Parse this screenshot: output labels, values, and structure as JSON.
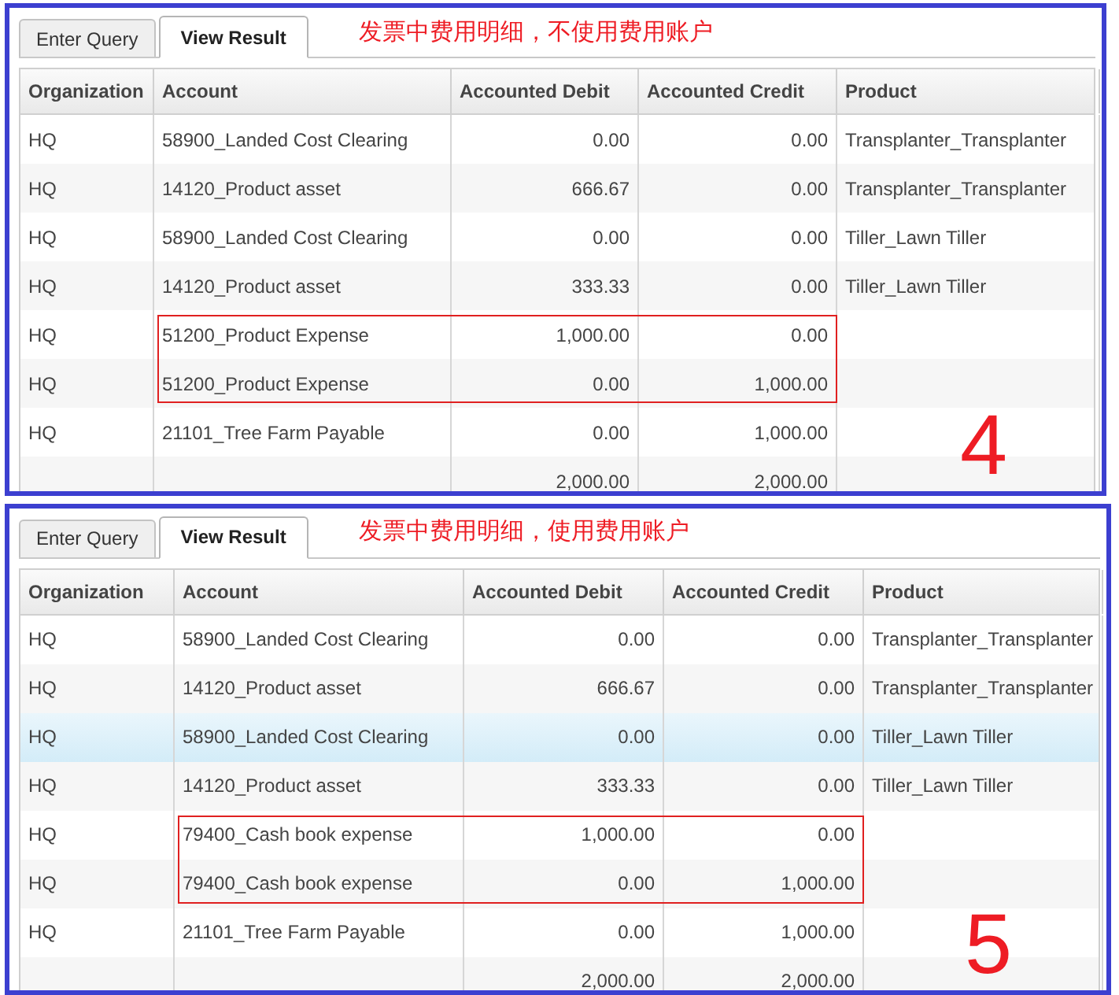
{
  "panels": [
    {
      "tabs": [
        {
          "label": "Enter Query",
          "selected": false
        },
        {
          "label": "View Result",
          "selected": true
        }
      ],
      "note": "发票中费用明细，不使用费用账户",
      "columns": [
        "Organization",
        "Account",
        "Accounted Debit",
        "Accounted Credit",
        "Product"
      ],
      "rows": [
        {
          "organization": "HQ",
          "account": "58900_Landed Cost Clearing",
          "debit": "0.00",
          "credit": "0.00",
          "product": "Transplanter_Transplanter",
          "selected": false,
          "highlighted": false
        },
        {
          "organization": "HQ",
          "account": "14120_Product asset",
          "debit": "666.67",
          "credit": "0.00",
          "product": "Transplanter_Transplanter",
          "selected": false,
          "highlighted": false
        },
        {
          "organization": "HQ",
          "account": "58900_Landed Cost Clearing",
          "debit": "0.00",
          "credit": "0.00",
          "product": "Tiller_Lawn Tiller",
          "selected": false,
          "highlighted": false
        },
        {
          "organization": "HQ",
          "account": "14120_Product asset",
          "debit": "333.33",
          "credit": "0.00",
          "product": "Tiller_Lawn Tiller",
          "selected": false,
          "highlighted": false
        },
        {
          "organization": "HQ",
          "account": "51200_Product Expense",
          "debit": "1,000.00",
          "credit": "0.00",
          "selected": false,
          "highlighted": true
        },
        {
          "organization": "HQ",
          "account": "51200_Product Expense",
          "debit": "0.00",
          "credit": "1,000.00",
          "selected": false,
          "highlighted": true
        },
        {
          "organization": "HQ",
          "account": "21101_Tree Farm Payable",
          "debit": "0.00",
          "credit": "1,000.00",
          "selected": false,
          "highlighted": false
        },
        {
          "debit": "2,000.00",
          "credit": "2,000.00",
          "selected": false,
          "highlighted": false
        }
      ],
      "step": "4"
    },
    {
      "tabs": [
        {
          "label": "Enter Query",
          "selected": false
        },
        {
          "label": "View Result",
          "selected": true
        }
      ],
      "note": "发票中费用明细，使用费用账户",
      "columns": [
        "Organization",
        "Account",
        "Accounted Debit",
        "Accounted Credit",
        "Product"
      ],
      "rows": [
        {
          "organization": "HQ",
          "account": "58900_Landed Cost Clearing",
          "debit": "0.00",
          "credit": "0.00",
          "product": "Transplanter_Transplanter",
          "selected": false,
          "highlighted": false
        },
        {
          "organization": "HQ",
          "account": "14120_Product asset",
          "debit": "666.67",
          "credit": "0.00",
          "product": "Transplanter_Transplanter",
          "selected": false,
          "highlighted": false
        },
        {
          "organization": "HQ",
          "account": "58900_Landed Cost Clearing",
          "debit": "0.00",
          "credit": "0.00",
          "product": "Tiller_Lawn Tiller",
          "selected": true,
          "highlighted": false
        },
        {
          "organization": "HQ",
          "account": "14120_Product asset",
          "debit": "333.33",
          "credit": "0.00",
          "product": "Tiller_Lawn Tiller",
          "selected": false,
          "highlighted": false
        },
        {
          "organization": "HQ",
          "account": "79400_Cash book expense",
          "debit": "1,000.00",
          "credit": "0.00",
          "selected": false,
          "highlighted": true
        },
        {
          "organization": "HQ",
          "account": "79400_Cash book expense",
          "debit": "0.00",
          "credit": "1,000.00",
          "selected": false,
          "highlighted": true
        },
        {
          "organization": "HQ",
          "account": "21101_Tree Farm Payable",
          "debit": "0.00",
          "credit": "1,000.00",
          "selected": false,
          "highlighted": false
        },
        {
          "debit": "2,000.00",
          "credit": "2,000.00",
          "selected": false,
          "highlighted": false
        }
      ],
      "step": "5"
    }
  ]
}
